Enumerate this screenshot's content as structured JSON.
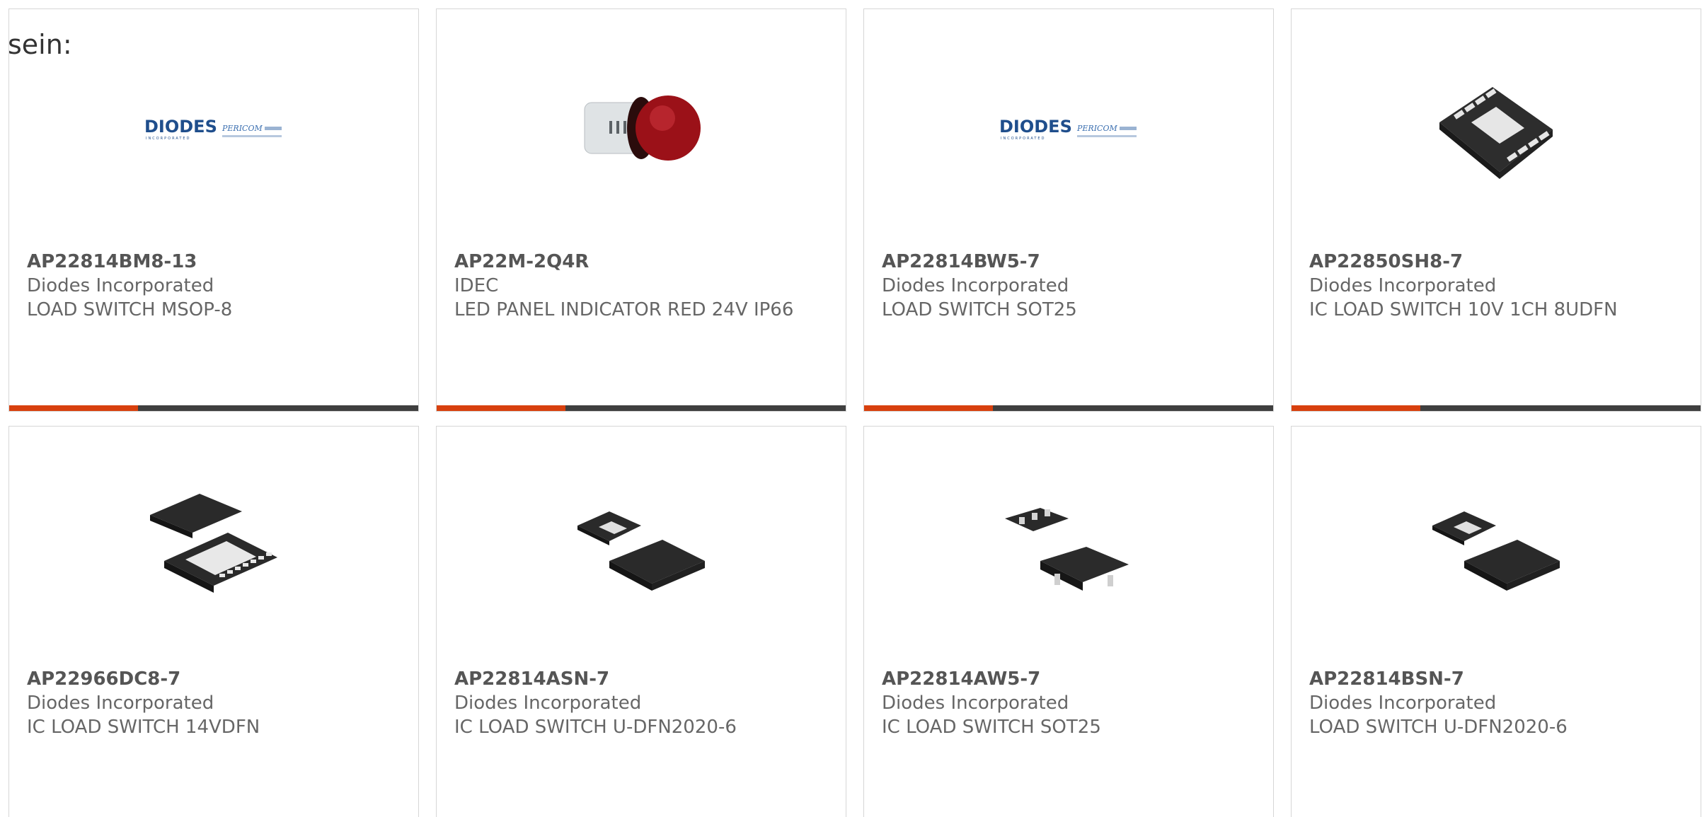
{
  "fragment_text": "sein:",
  "colors": {
    "accent": "#d8400e",
    "bar": "#3f3f3f",
    "border": "#d6d6d6",
    "text": "#666666"
  },
  "products": [
    {
      "part_number": "AP22814BM8-13",
      "manufacturer": "Diodes Incorporated",
      "description": "LOAD SWITCH MSOP-8",
      "image": "diodes-pericom-logo",
      "has_bar": true
    },
    {
      "part_number": "AP22M-2Q4R",
      "manufacturer": "IDEC",
      "description": "LED PANEL INDICATOR RED 24V IP66",
      "image": "red-indicator-lamp",
      "has_bar": true
    },
    {
      "part_number": "AP22814BW5-7",
      "manufacturer": "Diodes Incorporated",
      "description": "LOAD SWITCH SOT25",
      "image": "diodes-pericom-logo",
      "has_bar": true
    },
    {
      "part_number": "AP22850SH8-7",
      "manufacturer": "Diodes Incorporated",
      "description": "IC LOAD SWITCH 10V 1CH 8UDFN",
      "image": "8udfn-package",
      "has_bar": true
    },
    {
      "part_number": "AP22966DC8-7",
      "manufacturer": "Diodes Incorporated",
      "description": "IC LOAD SWITCH 14VDFN",
      "image": "14vdfn-package",
      "has_bar": false
    },
    {
      "part_number": "AP22814ASN-7",
      "manufacturer": "Diodes Incorporated",
      "description": "IC LOAD SWITCH U-DFN2020-6",
      "image": "udfn-package",
      "has_bar": false
    },
    {
      "part_number": "AP22814AW5-7",
      "manufacturer": "Diodes Incorporated",
      "description": "IC LOAD SWITCH SOT25",
      "image": "sot25-package",
      "has_bar": false
    },
    {
      "part_number": "AP22814BSN-7",
      "manufacturer": "Diodes Incorporated",
      "description": "LOAD SWITCH U-DFN2020-6",
      "image": "udfn-package",
      "has_bar": false
    }
  ],
  "logo": {
    "brand": "DIODES",
    "sub": "INCORPORATED",
    "partner": "PERICOM"
  }
}
